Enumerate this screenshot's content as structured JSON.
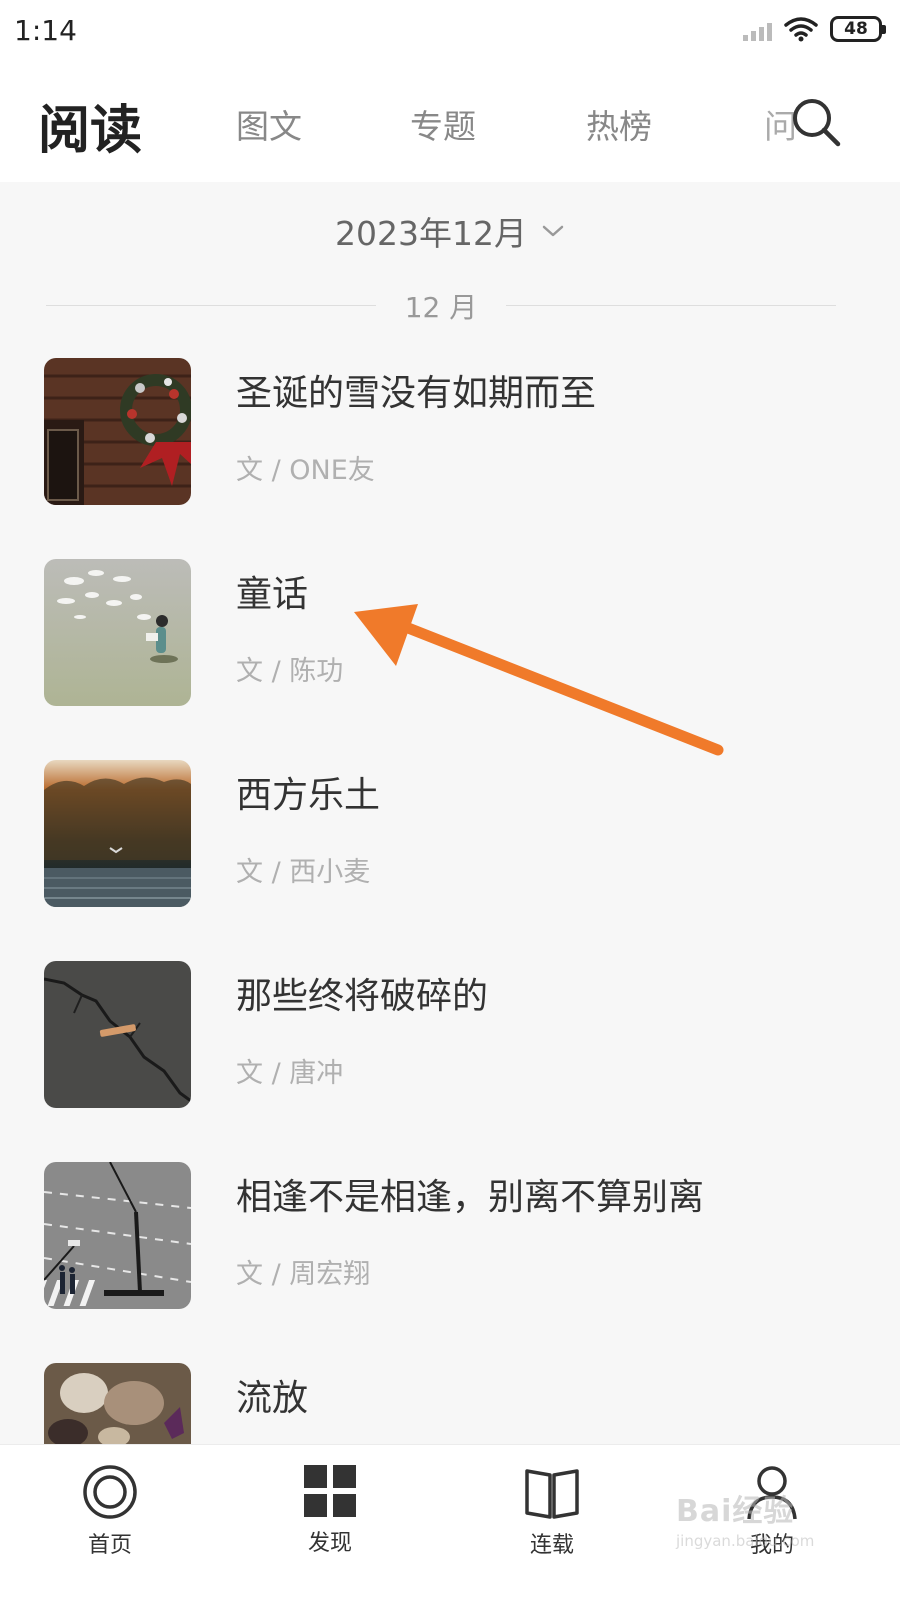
{
  "status_bar": {
    "time": "1:14",
    "battery": "48"
  },
  "top_nav": {
    "title": "阅读",
    "tabs": [
      {
        "label": "图文"
      },
      {
        "label": "专题"
      },
      {
        "label": "热榜"
      },
      {
        "label": "问"
      }
    ],
    "search_icon": "search-icon"
  },
  "month_selector": {
    "label": "2023年12月",
    "icon": "chevron-down-icon"
  },
  "section_label": "12 月",
  "articles": [
    {
      "title": "圣诞的雪没有如期而至",
      "author": "文 / ONE友"
    },
    {
      "title": "童话",
      "author": "文 / 陈功"
    },
    {
      "title": "西方乐土",
      "author": "文 / 西小麦"
    },
    {
      "title": "那些终将破碎的",
      "author": "文 / 唐冲"
    },
    {
      "title": "相逢不是相逢，别离不算别离",
      "author": "文 / 周宏翔"
    },
    {
      "title": "流放",
      "author": ""
    }
  ],
  "annotation": {
    "color": "#f07a2a"
  },
  "bottom_nav": {
    "items": [
      {
        "label": "首页",
        "icon": "home-icon"
      },
      {
        "label": "发现",
        "icon": "grid-icon"
      },
      {
        "label": "连载",
        "icon": "book-icon"
      },
      {
        "label": "我的",
        "icon": "person-icon"
      }
    ]
  },
  "watermark": {
    "logo": "Bai经验",
    "url": "jingyan.baidu.com"
  }
}
